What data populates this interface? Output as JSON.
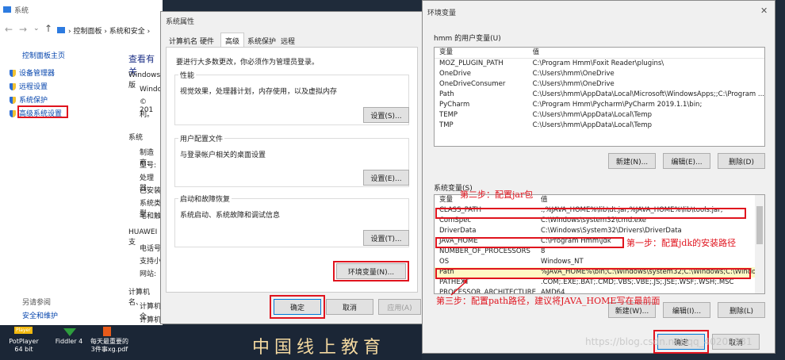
{
  "system_window": {
    "title": "系统",
    "breadcrumb": "› 控制面板 › 系统和安全 ›",
    "sidebar_home": "控制面板主页",
    "sidebar_links": [
      "设备管理器",
      "远程设置",
      "系统保护",
      "高级系统设置"
    ],
    "see_also": "另请参阅",
    "security": "安全和维护",
    "heading": "查看有关",
    "fragments": [
      "Windows 版",
      "Windo",
      "© 201",
      "利。",
      "系统",
      "制造商:",
      "型号:",
      "处理器:",
      "已安装",
      "系统类型",
      "笔和触",
      "HUAWEI 支",
      "电话号",
      "支持小",
      "网站:",
      "计算机名、",
      "计算机全",
      "计算机描"
    ]
  },
  "sysprops": {
    "title": "系统属性",
    "tabs": [
      "计算机名",
      "硬件",
      "高级",
      "系统保护",
      "远程"
    ],
    "admin_note": "要进行大多数更改，你必须作为管理员登录。",
    "perf_title": "性能",
    "perf_desc": "视觉效果，处理器计划，内存使用，以及虚拟内存",
    "perf_btn": "设置(S)...",
    "profile_title": "用户配置文件",
    "profile_desc": "与登录帐户相关的桌面设置",
    "profile_btn": "设置(E)...",
    "startup_title": "启动和故障恢复",
    "startup_desc": "系统启动、系统故障和调试信息",
    "startup_btn": "设置(T)...",
    "env_btn": "环境变量(N)...",
    "ok": "确定",
    "cancel": "取消",
    "apply": "应用(A)"
  },
  "envvars": {
    "title": "环境变量",
    "close": "✕",
    "user_label": "hmm 的用户变量(U)",
    "col_var": "变量",
    "col_val": "值",
    "user_rows": [
      {
        "name": "MOZ_PLUGIN_PATH",
        "value": "C:\\Program Hmm\\Foxit Reader\\plugins\\"
      },
      {
        "name": "OneDrive",
        "value": "C:\\Users\\hmm\\OneDrive"
      },
      {
        "name": "OneDriveConsumer",
        "value": "C:\\Users\\hmm\\OneDrive"
      },
      {
        "name": "Path",
        "value": "C:\\Users\\hmm\\AppData\\Local\\Microsoft\\WindowsApps;;C:\\Program ..."
      },
      {
        "name": "PyCharm",
        "value": "C:\\Program Hmm\\Pycharm\\PyCharm 2019.1.1\\bin;"
      },
      {
        "name": "TEMP",
        "value": "C:\\Users\\hmm\\AppData\\Local\\Temp"
      },
      {
        "name": "TMP",
        "value": "C:\\Users\\hmm\\AppData\\Local\\Temp"
      }
    ],
    "user_new": "新建(N)...",
    "user_edit": "编辑(E)...",
    "user_delete": "删除(D)",
    "sys_label": "系统变量(S)",
    "sys_rows": [
      {
        "name": "CLASS_PATH",
        "value": ".;%JAVA_HOME%\\lib\\dt.jar;%JAVA_HOME%\\lib\\tools.jar;"
      },
      {
        "name": "ComSpec",
        "value": "C:\\Windows\\system32\\cmd.exe"
      },
      {
        "name": "DriverData",
        "value": "C:\\Windows\\System32\\Drivers\\DriverData"
      },
      {
        "name": "JAVA_HOME",
        "value": "C:\\Program Hmm\\jdk"
      },
      {
        "name": "NUMBER_OF_PROCESSORS",
        "value": "8"
      },
      {
        "name": "OS",
        "value": "Windows_NT"
      },
      {
        "name": "Path",
        "value": "%JAVA_HOME%\\bin;C:\\Windows\\system32;C:\\Windows;C:\\Windo..."
      },
      {
        "name": "PATHEXT",
        "value": ".COM;.EXE;.BAT;.CMD;.VBS;.VBE;.JS;.JSE;.WSF;.WSH;.MSC"
      },
      {
        "name": "PROCESSOR_ARCHITECTURE",
        "value": "AMD64"
      }
    ],
    "sys_new": "新建(W)...",
    "sys_edit": "编辑(I)...",
    "sys_delete": "删除(L)",
    "ok": "确定",
    "cancel": "取消"
  },
  "annotations": {
    "step1": "第一步：配置jdk的安装路径",
    "step2": "第二步：配置jar包",
    "step3": "第三步：配置path路径，建议将JAVA_HOME写在最前面"
  },
  "taskbar": {
    "items": [
      {
        "label": "PotPlayer\n64 bit",
        "badge": "Player"
      },
      {
        "label": "Fiddler 4"
      },
      {
        "label": "每天最重要的\n3件事xg.pdf"
      }
    ],
    "banner": "中国线上教育",
    "watermark": "https://blog.csdn.net/qq_40209331"
  },
  "colors": {
    "annotation_red": "#e0141e",
    "accent": "#0078d7"
  }
}
